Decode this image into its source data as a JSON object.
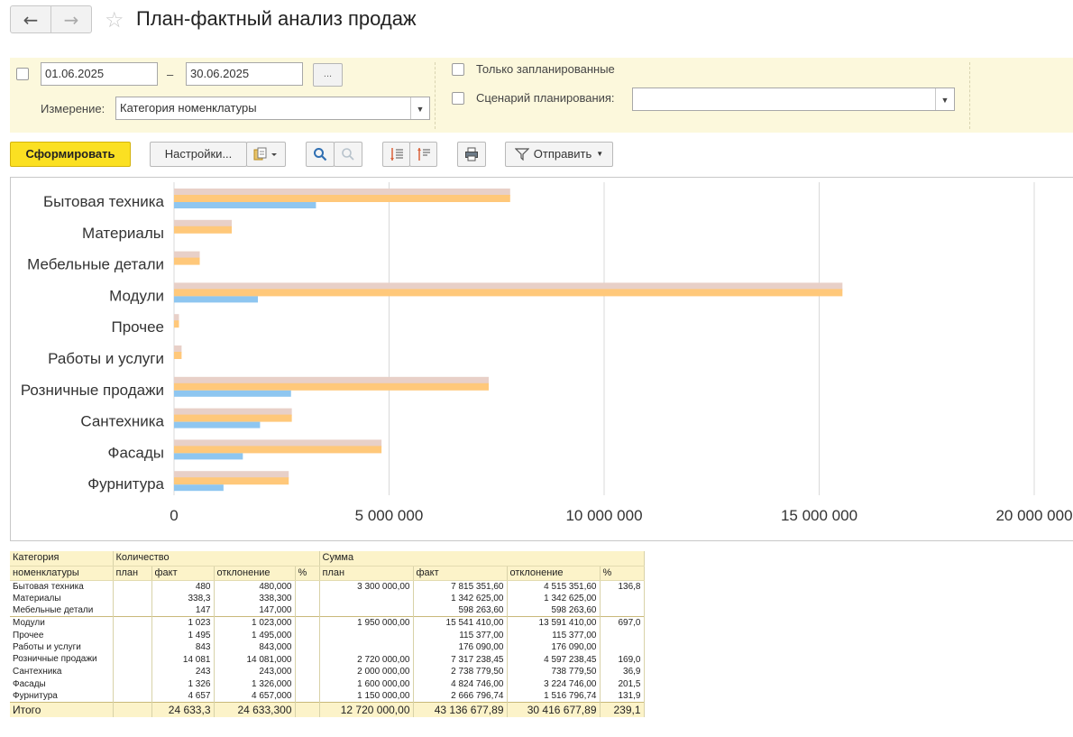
{
  "header": {
    "back_icon": "arrow-left-icon",
    "forward_icon": "arrow-right-icon",
    "favorite_icon": "star-icon",
    "title": "План-фактный анализ продаж"
  },
  "filters": {
    "date_from": "01.06.2025",
    "date_dash": "–",
    "date_to": "30.06.2025",
    "period_button": "...",
    "dimension_label": "Измерение:",
    "dimension_value": "Категория номенклатуры",
    "only_planned_label": "Только запланированные",
    "scenario_label": "Сценарий планирования:",
    "scenario_value": ""
  },
  "toolbar": {
    "generate_label": "Сформировать",
    "settings_label": "Настройки...",
    "send_label": "Отправить",
    "variants_icon": "report-variants-icon",
    "search_icon": "search-icon",
    "refresh_icon": "refresh-icon",
    "expand_icon": "expand-groups-icon",
    "collapse_icon": "collapse-groups-icon",
    "print_icon": "printer-icon",
    "send_icon": "send-icon"
  },
  "chart_data": {
    "type": "bar",
    "orientation": "horizontal",
    "categories": [
      "Бытовая техника",
      "Материалы",
      "Мебельные детали",
      "Модули",
      "Прочее",
      "Работы и услуги",
      "Розничные продажи",
      "Сантехника",
      "Фасады",
      "Фурнитура"
    ],
    "series": [
      {
        "color": "#e8d0c8",
        "values": [
          7815351.6,
          1342625.0,
          598263.6,
          15541410.0,
          115377.0,
          176090.0,
          7317238.45,
          2738779.5,
          4824746.0,
          2666796.74
        ]
      },
      {
        "color": "#ffc87a",
        "values": [
          7815351.6,
          1342625.0,
          598263.6,
          15541410.0,
          115377.0,
          176090.0,
          7317238.45,
          2738779.5,
          4824746.0,
          2666796.74
        ]
      },
      {
        "color": "#8ec6f0",
        "values": [
          3300000,
          0,
          0,
          1950000,
          0,
          0,
          2720000,
          2000000,
          1600000,
          1150000
        ]
      }
    ],
    "xlim": [
      0,
      20000000
    ],
    "xticks": [
      "0",
      "5 000 000",
      "10 000 000",
      "15 000 000",
      "20 000 000"
    ],
    "grid": true,
    "title": "",
    "xlabel": "",
    "ylabel": ""
  },
  "table": {
    "head1": [
      "Категория",
      "Количество",
      "Сумма"
    ],
    "head2": [
      "номенклатуры",
      "план",
      "факт",
      "отклонение",
      "%",
      "план",
      "факт",
      "отклонение",
      "%"
    ],
    "rows": [
      {
        "name": "Бытовая техника",
        "q_plan": "",
        "q_fact": "480",
        "q_dev": "480,000",
        "q_pct": "",
        "s_plan": "3 300 000,00",
        "s_fact": "7 815 351,60",
        "s_dev": "4 515 351,60",
        "s_pct": "136,8"
      },
      {
        "name": "Материалы",
        "q_plan": "",
        "q_fact": "338,3",
        "q_dev": "338,300",
        "q_pct": "",
        "s_plan": "",
        "s_fact": "1 342 625,00",
        "s_dev": "1 342 625,00",
        "s_pct": ""
      },
      {
        "name": "Мебельные детали",
        "q_plan": "",
        "q_fact": "147",
        "q_dev": "147,000",
        "q_pct": "",
        "s_plan": "",
        "s_fact": "598 263,60",
        "s_dev": "598 263,60",
        "s_pct": ""
      },
      {
        "name": "Модули",
        "q_plan": "",
        "q_fact": "1 023",
        "q_dev": "1 023,000",
        "q_pct": "",
        "s_plan": "1 950 000,00",
        "s_fact": "15 541 410,00",
        "s_dev": "13 591 410,00",
        "s_pct": "697,0"
      },
      {
        "name": "Прочее",
        "q_plan": "",
        "q_fact": "1 495",
        "q_dev": "1 495,000",
        "q_pct": "",
        "s_plan": "",
        "s_fact": "115 377,00",
        "s_dev": "115 377,00",
        "s_pct": ""
      },
      {
        "name": "Работы и услуги",
        "q_plan": "",
        "q_fact": "843",
        "q_dev": "843,000",
        "q_pct": "",
        "s_plan": "",
        "s_fact": "176 090,00",
        "s_dev": "176 090,00",
        "s_pct": ""
      },
      {
        "name": "Розничные продажи",
        "q_plan": "",
        "q_fact": "14 081",
        "q_dev": "14 081,000",
        "q_pct": "",
        "s_plan": "2 720 000,00",
        "s_fact": "7 317 238,45",
        "s_dev": "4 597 238,45",
        "s_pct": "169,0"
      },
      {
        "name": "Сантехника",
        "q_plan": "",
        "q_fact": "243",
        "q_dev": "243,000",
        "q_pct": "",
        "s_plan": "2 000 000,00",
        "s_fact": "2 738 779,50",
        "s_dev": "738 779,50",
        "s_pct": "36,9"
      },
      {
        "name": "Фасады",
        "q_plan": "",
        "q_fact": "1 326",
        "q_dev": "1 326,000",
        "q_pct": "",
        "s_plan": "1 600 000,00",
        "s_fact": "4 824 746,00",
        "s_dev": "3 224 746,00",
        "s_pct": "201,5"
      },
      {
        "name": "Фурнитура",
        "q_plan": "",
        "q_fact": "4 657",
        "q_dev": "4 657,000",
        "q_pct": "",
        "s_plan": "1 150 000,00",
        "s_fact": "2 666 796,74",
        "s_dev": "1 516 796,74",
        "s_pct": "131,9"
      }
    ],
    "total": {
      "name": "Итого",
      "q_plan": "",
      "q_fact": "24 633,3",
      "q_dev": "24 633,300",
      "q_pct": "",
      "s_plan": "12 720 000,00",
      "s_fact": "43 136 677,89",
      "s_dev": "30 416 677,89",
      "s_pct": "239,1"
    }
  }
}
